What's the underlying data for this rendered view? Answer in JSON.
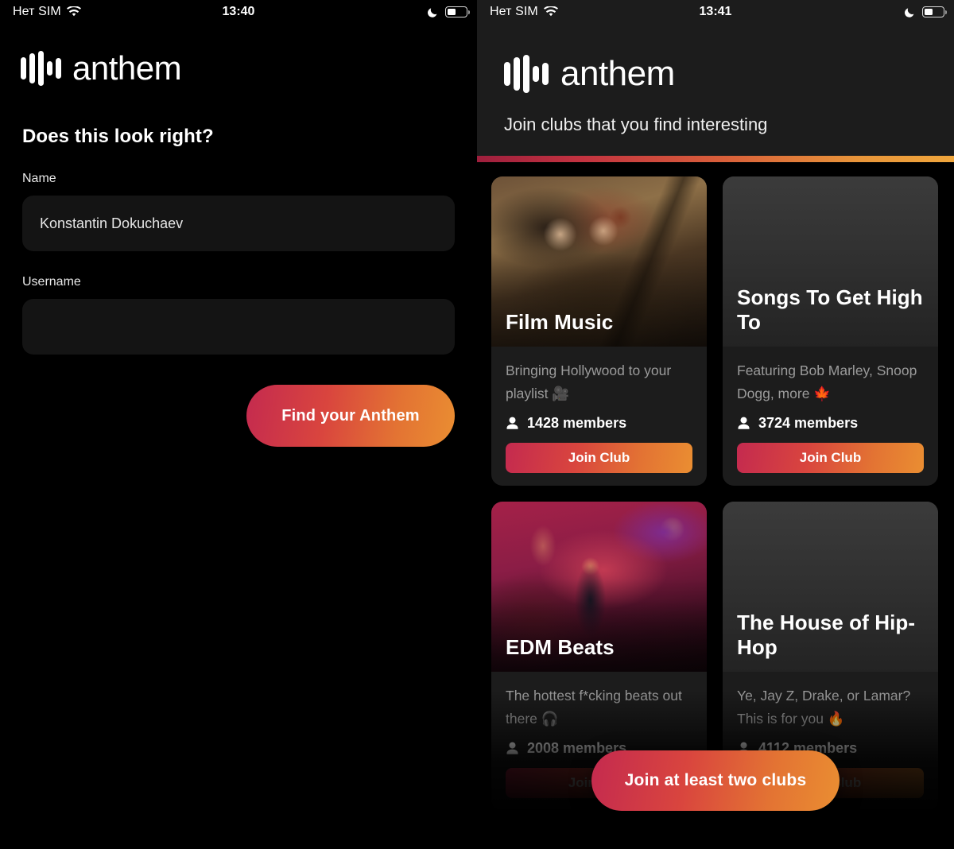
{
  "left_screen": {
    "status_bar": {
      "carrier": "Нет SIM",
      "wifi_icon": "wifi-icon",
      "time": "13:40",
      "dnd_icon": "moon-icon",
      "battery_icon": "battery-icon"
    },
    "brand": {
      "logo_icon": "anthem-waveform-icon",
      "wordmark": "anthem"
    },
    "form": {
      "title": "Does this look right?",
      "fields": [
        {
          "label": "Name",
          "value": "Konstantin Dokuchaev",
          "placeholder": ""
        },
        {
          "label": "Username",
          "value": "",
          "placeholder": ""
        }
      ],
      "submit_label": "Find your Anthem"
    }
  },
  "right_screen": {
    "status_bar": {
      "carrier": "Нет SIM",
      "wifi_icon": "wifi-icon",
      "time": "13:41",
      "dnd_icon": "moon-icon",
      "battery_icon": "battery-icon"
    },
    "brand": {
      "logo_icon": "anthem-waveform-icon",
      "wordmark": "anthem"
    },
    "subtitle": "Join clubs that you find interesting",
    "clubs": [
      {
        "title": "Film Music",
        "description": "Bringing Hollywood to your playlist 🎥",
        "members": "1428 members",
        "join_label": "Join Club",
        "has_photo": true
      },
      {
        "title": "Songs To Get High To",
        "description": "Featuring Bob Marley, Snoop Dogg, more 🍁",
        "members": "3724 members",
        "join_label": "Join Club",
        "has_photo": false
      },
      {
        "title": "EDM Beats",
        "description": "The hottest f*cking beats out there 🎧",
        "members": "2008 members",
        "join_label": "Join Club",
        "has_photo": true
      },
      {
        "title": "The House of Hip-Hop",
        "description": "Ye, Jay Z, Drake, or Lamar? This is for you 🔥",
        "members": "4112 members",
        "join_label": "Join Club",
        "has_photo": false
      }
    ],
    "floating_action_label": "Join at least two clubs"
  },
  "theme": {
    "background": "#000000",
    "surface": "#1c1c1c",
    "input_surface": "#141414",
    "accent_start": "#c42a4f",
    "accent_end": "#ea8e32",
    "text_primary": "#ffffff",
    "text_secondary": "#9b9b9b"
  }
}
